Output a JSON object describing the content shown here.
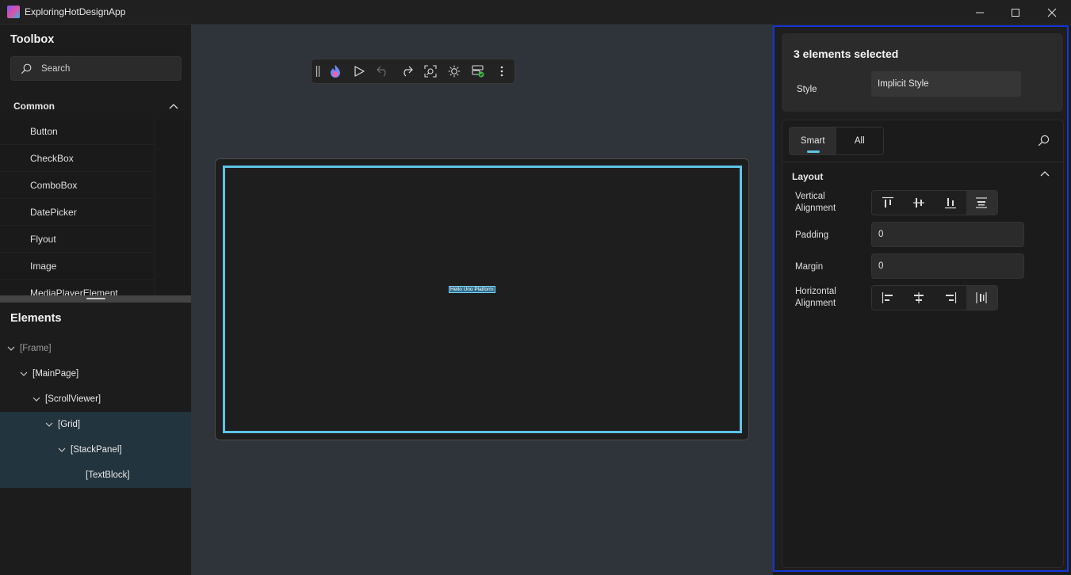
{
  "window": {
    "title": "ExploringHotDesignApp"
  },
  "toolbox": {
    "title": "Toolbox",
    "search_placeholder": "Search",
    "group": "Common",
    "items": [
      "Button",
      "CheckBox",
      "ComboBox",
      "DatePicker",
      "Flyout",
      "Image",
      "MediaPlayerElement"
    ]
  },
  "elements": {
    "title": "Elements",
    "tree": [
      {
        "label": "[Frame]",
        "expanded": true,
        "selected": false,
        "dim": true
      },
      {
        "label": "[MainPage]",
        "expanded": true,
        "selected": false
      },
      {
        "label": "[ScrollViewer]",
        "expanded": true,
        "selected": false
      },
      {
        "label": "[Grid]",
        "expanded": true,
        "selected": true
      },
      {
        "label": "[StackPanel]",
        "expanded": true,
        "selected": true
      },
      {
        "label": "[TextBlock]",
        "expanded": false,
        "selected": true
      }
    ]
  },
  "toolbar": {
    "icons": [
      "hot-design-flame-icon",
      "play-icon",
      "undo-icon",
      "redo-icon",
      "zoom-fit-icon",
      "theme-icon",
      "connected-server-icon",
      "more-icon"
    ]
  },
  "canvas": {
    "text": "Hello Uno Platform"
  },
  "properties": {
    "selection_title": "3 elements selected",
    "style_label": "Style",
    "style_value": "Implicit Style",
    "tabs": [
      "Smart",
      "All"
    ],
    "active_tab": "Smart",
    "section": "Layout",
    "vertical_alignment_label": "Vertical Alignment",
    "vertical_alignment_selected": "Stretch",
    "padding_label": "Padding",
    "padding_value": "0",
    "margin_label": "Margin",
    "margin_value": "0",
    "horizontal_alignment_label": "Horizontal Alignment",
    "horizontal_alignment_selected": "Stretch"
  },
  "colors": {
    "accent": "#5ec4e8",
    "selection_border": "#1636d8",
    "selected_tree_row": "#22343d"
  }
}
